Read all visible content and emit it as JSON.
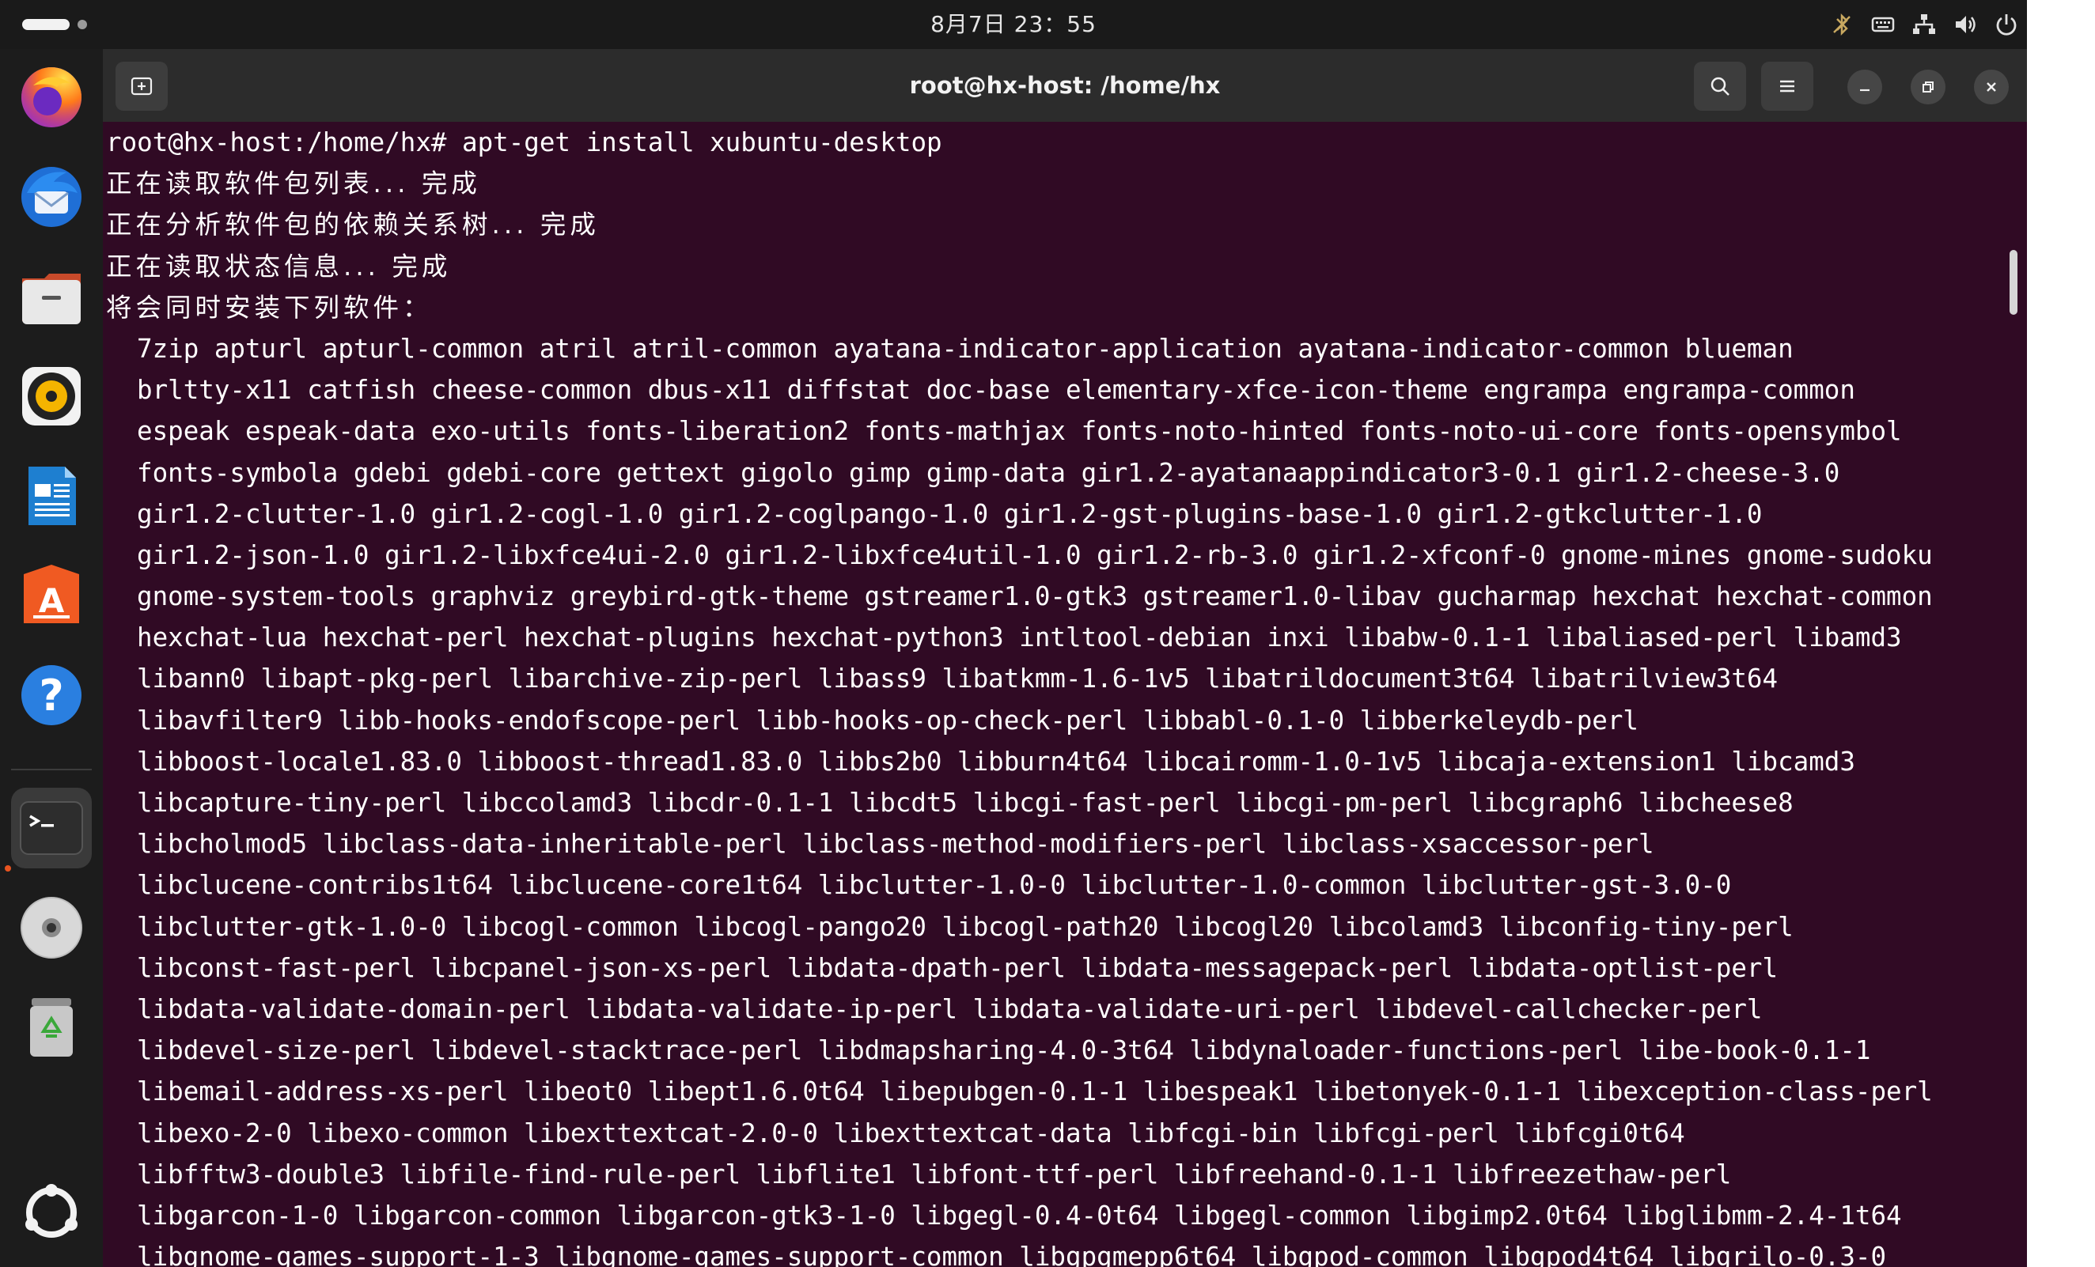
{
  "topbar": {
    "clock": "8月7日 23：55",
    "tray_icons": [
      "no-bluetooth-icon",
      "keyboard-icon",
      "network-icon",
      "volume-icon",
      "power-icon"
    ]
  },
  "dock": {
    "apps": [
      "firefox-icon",
      "thunderbird-icon",
      "files-icon",
      "rhythmbox-icon",
      "libreoffice-writer-icon",
      "app-center-icon",
      "help-icon",
      "terminal-icon",
      "disc-icon",
      "trash-icon"
    ],
    "show_apps": "show-apps-icon",
    "active_app": "terminal-icon"
  },
  "window": {
    "title": "root@hx-host: /home/hx",
    "new_tab_icon": "new-tab-icon",
    "search_icon": "search-icon",
    "menu_icon": "menu-icon",
    "minimize_icon": "minimize-icon",
    "restore_icon": "restore-icon",
    "close_icon": "close-icon"
  },
  "terminal": {
    "prompt": "root@hx-host:/home/hx# apt-get install xubuntu-desktop",
    "status_lines": [
      "正在读取软件包列表... 完成",
      "正在分析软件包的依赖关系树... 完成",
      "正在读取状态信息... 完成",
      "将会同时安装下列软件："
    ],
    "package_lines": [
      "7zip apturl apturl-common atril atril-common ayatana-indicator-application ayatana-indicator-common blueman",
      "brltty-x11 catfish cheese-common dbus-x11 diffstat doc-base elementary-xfce-icon-theme engrampa engrampa-common",
      "espeak espeak-data exo-utils fonts-liberation2 fonts-mathjax fonts-noto-hinted fonts-noto-ui-core fonts-opensymbol",
      "fonts-symbola gdebi gdebi-core gettext gigolo gimp gimp-data gir1.2-ayatanaappindicator3-0.1 gir1.2-cheese-3.0",
      "gir1.2-clutter-1.0 gir1.2-cogl-1.0 gir1.2-coglpango-1.0 gir1.2-gst-plugins-base-1.0 gir1.2-gtkclutter-1.0",
      "gir1.2-json-1.0 gir1.2-libxfce4ui-2.0 gir1.2-libxfce4util-1.0 gir1.2-rb-3.0 gir1.2-xfconf-0 gnome-mines gnome-sudoku",
      "gnome-system-tools graphviz greybird-gtk-theme gstreamer1.0-gtk3 gstreamer1.0-libav gucharmap hexchat hexchat-common",
      "hexchat-lua hexchat-perl hexchat-plugins hexchat-python3 intltool-debian inxi libabw-0.1-1 libaliased-perl libamd3",
      "libann0 libapt-pkg-perl libarchive-zip-perl libass9 libatkmm-1.6-1v5 libatrildocument3t64 libatrilview3t64",
      "libavfilter9 libb-hooks-endofscope-perl libb-hooks-op-check-perl libbabl-0.1-0 libberkeleydb-perl",
      "libboost-locale1.83.0 libboost-thread1.83.0 libbs2b0 libburn4t64 libcairomm-1.0-1v5 libcaja-extension1 libcamd3",
      "libcapture-tiny-perl libccolamd3 libcdr-0.1-1 libcdt5 libcgi-fast-perl libcgi-pm-perl libcgraph6 libcheese8",
      "libcholmod5 libclass-data-inheritable-perl libclass-method-modifiers-perl libclass-xsaccessor-perl",
      "libclucene-contribs1t64 libclucene-core1t64 libclutter-1.0-0 libclutter-1.0-common libclutter-gst-3.0-0",
      "libclutter-gtk-1.0-0 libcogl-common libcogl-pango20 libcogl-path20 libcogl20 libcolamd3 libconfig-tiny-perl",
      "libconst-fast-perl libcpanel-json-xs-perl libdata-dpath-perl libdata-messagepack-perl libdata-optlist-perl",
      "libdata-validate-domain-perl libdata-validate-ip-perl libdata-validate-uri-perl libdevel-callchecker-perl",
      "libdevel-size-perl libdevel-stacktrace-perl libdmapsharing-4.0-3t64 libdynaloader-functions-perl libe-book-0.1-1",
      "libemail-address-xs-perl libeot0 libept1.6.0t64 libepubgen-0.1-1 libespeak1 libetonyek-0.1-1 libexception-class-perl",
      "libexo-2-0 libexo-common libexttextcat-2.0-0 libexttextcat-data libfcgi-bin libfcgi-perl libfcgi0t64",
      "libfftw3-double3 libfile-find-rule-perl libflite1 libfont-ttf-perl libfreehand-0.1-1 libfreezethaw-perl",
      "libgarcon-1-0 libgarcon-common libgarcon-gtk3-1-0 libgegl-0.4-0t64 libgegl-common libgimp2.0t64 libglibmm-2.4-1t64",
      "libgnome-games-support-1-3 libgnome-games-support-common libgpgmepp6t64 libgpod-common libgpod4t64 libgrilo-0.3-0"
    ]
  }
}
